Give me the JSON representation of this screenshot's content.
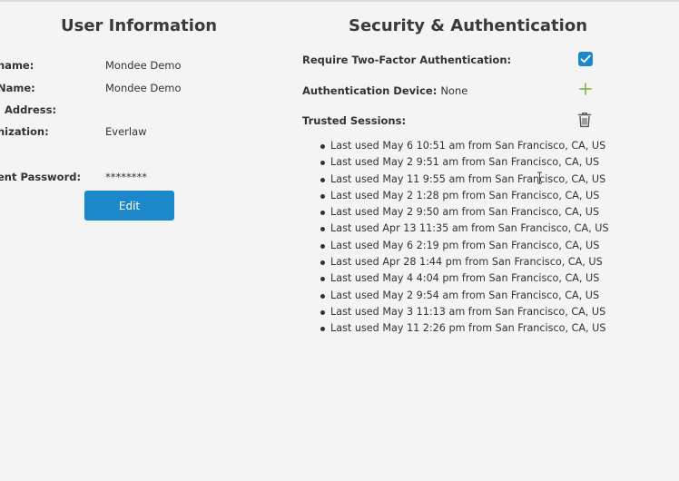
{
  "user_info": {
    "title": "User Information",
    "rows": [
      {
        "label": "name:",
        "value": "Mondee Demo"
      },
      {
        "label": "Name:",
        "value": "Mondee Demo"
      },
      {
        "label": "l Address:",
        "value": ""
      },
      {
        "label": "nization:",
        "value": "Everlaw"
      },
      {
        "label": "ent Password:",
        "value": "********"
      }
    ],
    "edit_label": "Edit"
  },
  "security": {
    "title": "Security & Authentication",
    "two_factor_label": "Require Two-Factor Authentication:",
    "two_factor_checked": true,
    "auth_device_label": "Authentication Device:",
    "auth_device_value": "None",
    "trusted_sessions_label": "Trusted Sessions:",
    "sessions": [
      "Last used May 6 10:51 am from San Francisco, CA, US",
      "Last used May 2 9:51 am from San Francisco, CA, US",
      "Last used May 11 9:55 am from San Francisco, CA, US",
      "Last used May 2 1:28 pm from San Francisco, CA, US",
      "Last used May 2 9:50 am from San Francisco, CA, US",
      "Last used Apr 13 11:35 am from San Francisco, CA, US",
      "Last used May 6 2:19 pm from San Francisco, CA, US",
      "Last used Apr 28 1:44 pm from San Francisco, CA, US",
      "Last used May 4 4:04 pm from San Francisco, CA, US",
      "Last used May 2 9:54 am from San Francisco, CA, US",
      "Last used May 3 11:13 am from San Francisco, CA, US",
      "Last used May 11 2:26 pm from San Francisco, CA, US"
    ]
  },
  "colors": {
    "accent": "#1c87c9",
    "plus": "#6cb33f",
    "background": "#f4f4f4"
  },
  "icons": {
    "checkbox": "checkbox-checked-icon",
    "add": "plus-icon",
    "delete": "trash-icon",
    "cursor": "text-cursor-icon"
  }
}
